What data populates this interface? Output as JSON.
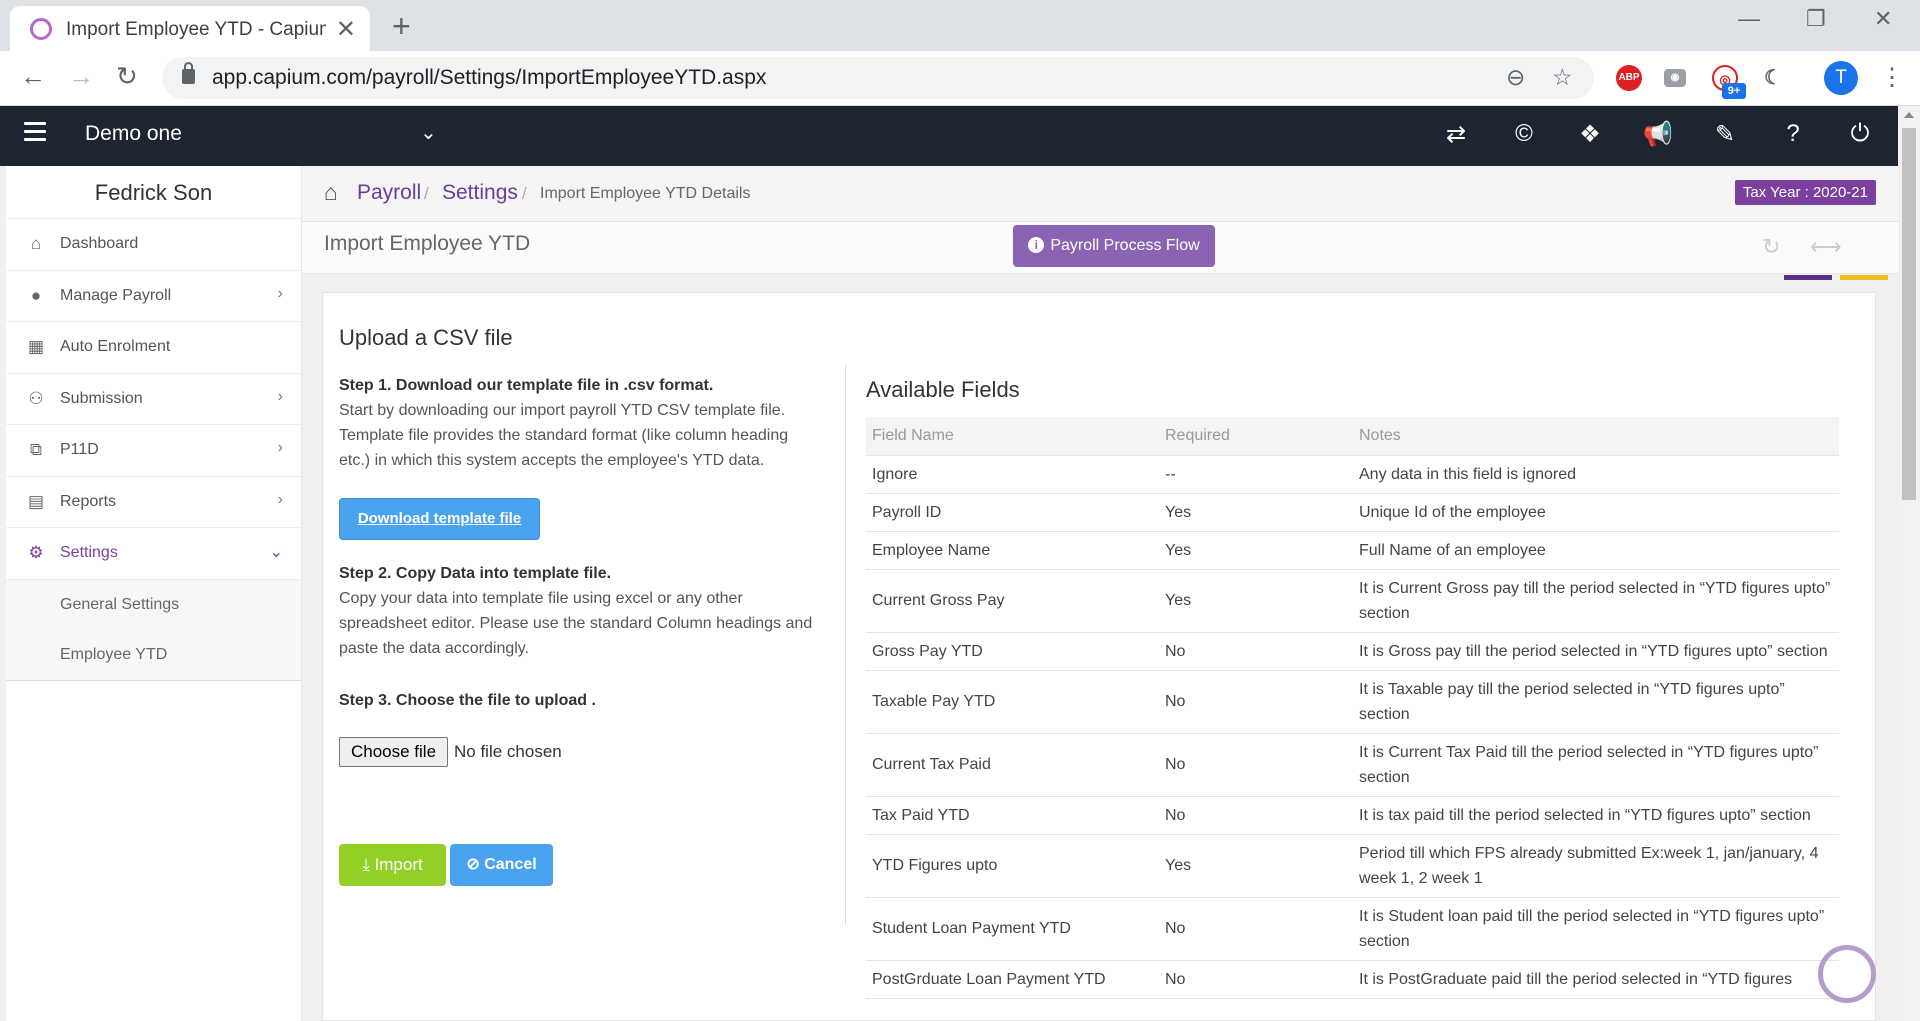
{
  "browser": {
    "tab_title": "Import Employee YTD - Capium P",
    "url": "app.capium.com/payroll/Settings/ImportEmployeeYTD.aspx",
    "avatar_letter": "T",
    "ext_abp": "ABP",
    "ext_badge": "9+"
  },
  "header": {
    "company": "Demo one"
  },
  "sidebar": {
    "user_name": "Fedrick Son",
    "items": [
      {
        "label": "Dashboard",
        "icon": "home-icon"
      },
      {
        "label": "Manage Payroll",
        "icon": "user-icon"
      },
      {
        "label": "Auto Enrolment",
        "icon": "grid-icon"
      },
      {
        "label": "Submission",
        "icon": "users-icon"
      },
      {
        "label": "P11D",
        "icon": "copy-icon"
      },
      {
        "label": "Reports",
        "icon": "report-icon"
      },
      {
        "label": "Settings",
        "icon": "gear-icon"
      }
    ],
    "sub_items": [
      "General Settings",
      "Employee YTD"
    ]
  },
  "breadcrumb": {
    "items": [
      "Payroll",
      "Settings"
    ],
    "current": "Import Employee YTD Details",
    "tax_year": "Tax Year : 2020-21"
  },
  "page": {
    "title": "Import Employee YTD",
    "process_flow_label": "Payroll Process Flow"
  },
  "upload": {
    "title": "Upload a CSV file",
    "step1_heading": "Step 1. Download our template file in .csv format.",
    "step1_text": "Start by downloading our import payroll YTD CSV template file. Template file provides the standard format (like column heading etc.) in which this system accepts the employee's YTD data.",
    "download_label": "Download template file",
    "step2_heading": "Step 2. Copy Data into template file.",
    "step2_text": "Copy your data into template file using excel or any other spreadsheet editor. Please use the standard Column headings and paste the data accordingly.",
    "step3_heading": "Step 3. Choose the file to upload .",
    "choose_file_label": "Choose file",
    "file_status": "No file chosen",
    "import_label": "Import",
    "cancel_label": "Cancel"
  },
  "fields": {
    "title": "Available Fields",
    "headers": [
      "Field Name",
      "Required",
      "Notes"
    ],
    "rows": [
      [
        "Ignore",
        "--",
        "Any data in this field is ignored"
      ],
      [
        "Payroll ID",
        "Yes",
        "Unique Id of the employee"
      ],
      [
        "Employee Name",
        "Yes",
        "Full Name of an employee"
      ],
      [
        "Current Gross Pay",
        "Yes",
        "It is Current Gross pay till the period selected in “YTD figures upto” section"
      ],
      [
        "Gross Pay YTD",
        "No",
        "It is Gross pay till the period selected in “YTD figures upto” section"
      ],
      [
        "Taxable Pay YTD",
        "No",
        "It is Taxable pay till the period selected in “YTD figures upto” section"
      ],
      [
        "Current Tax Paid",
        "No",
        "It is Current Tax Paid till the period selected in “YTD figures upto” section"
      ],
      [
        "Tax Paid YTD",
        "No",
        "It is tax paid till the period selected in “YTD figures upto” section"
      ],
      [
        "YTD Figures upto",
        "Yes",
        "Period till which FPS already submitted Ex:week 1, jan/january, 4 week 1, 2 week 1"
      ],
      [
        "Student Loan Payment YTD",
        "No",
        "It is Student loan paid till the period selected in “YTD figures upto” section"
      ],
      [
        "PostGrduate Loan Payment YTD",
        "No",
        "It is PostGraduate paid till the period selected in “YTD figures"
      ]
    ]
  },
  "colors": {
    "accent": "#7b3f9e",
    "header_bg": "#1d2530",
    "import_green": "#93d026",
    "button_blue": "#4aa3ee"
  }
}
